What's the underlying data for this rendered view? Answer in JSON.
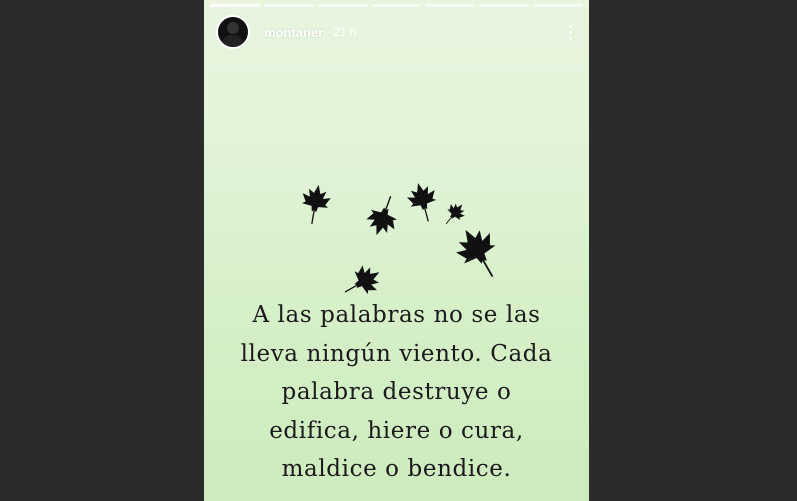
{
  "story": {
    "username": "montaner",
    "time": "21 h",
    "progress_segments": 7,
    "progress_done": 1,
    "quote_lines": [
      "A las palabras no se las",
      "lleva ningún viento. Cada",
      "palabra destruye o",
      "edifica, hiere o cura,",
      "maldice o bendice."
    ]
  },
  "icons": {
    "menu": "more-vertical-icon",
    "leaf": "maple-leaf-icon"
  },
  "colors": {
    "background": "#2b2b2b",
    "story_top": "#e9f5df",
    "story_bottom": "#cdebbe",
    "leaf": "#111111",
    "text": "#1a1a1a"
  }
}
